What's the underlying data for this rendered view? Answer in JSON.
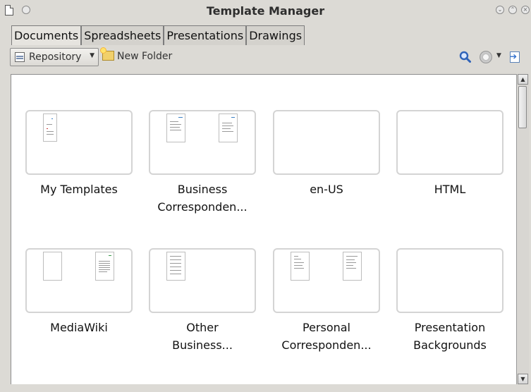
{
  "window": {
    "title": "Template Manager"
  },
  "tabs": [
    {
      "label": "Documents",
      "active": true
    },
    {
      "label": "Spreadsheets",
      "active": false
    },
    {
      "label": "Presentations",
      "active": false
    },
    {
      "label": "Drawings",
      "active": false
    }
  ],
  "toolbar": {
    "repository_label": "Repository",
    "new_folder_label": "New Folder"
  },
  "folders": [
    {
      "label_line1": "My Templates",
      "label_line2": ""
    },
    {
      "label_line1": "Business",
      "label_line2": "Corresponden..."
    },
    {
      "label_line1": "en-US",
      "label_line2": ""
    },
    {
      "label_line1": "HTML",
      "label_line2": ""
    },
    {
      "label_line1": "MediaWiki",
      "label_line2": ""
    },
    {
      "label_line1": "Other",
      "label_line2": "Business..."
    },
    {
      "label_line1": "Personal",
      "label_line2": "Corresponden..."
    },
    {
      "label_line1": "Presentation",
      "label_line2": "Backgrounds"
    }
  ],
  "colors": {
    "window_bg": "#dcdad5",
    "tile_border": "#d4d4d4",
    "search_icon": "#2f63b8"
  },
  "icons": {
    "search": "search-icon",
    "settings": "gear-icon",
    "import": "import-icon"
  }
}
